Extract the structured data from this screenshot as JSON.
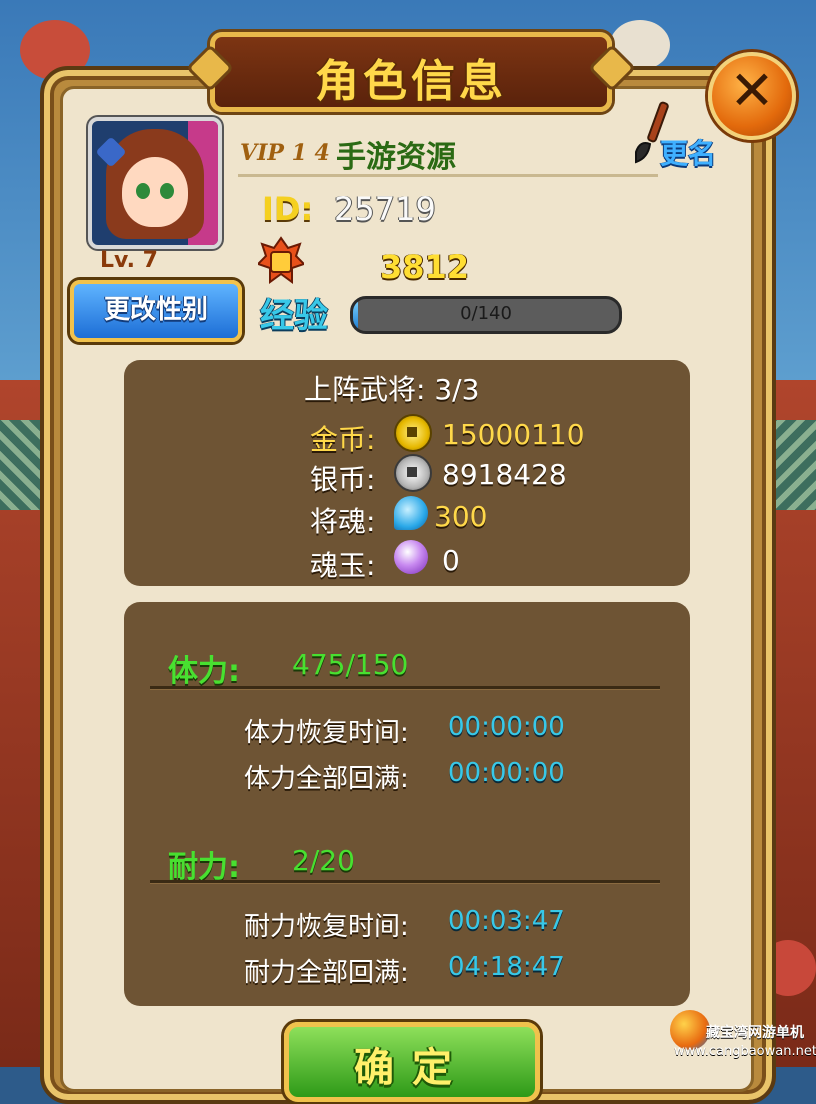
{
  "dialog": {
    "title": "角色信息",
    "close_symbol": "✕",
    "confirm_label": "确定"
  },
  "player": {
    "vip": "VIP 1 4",
    "name": "手游资源",
    "rename_label": "更名",
    "id_label": "ID:",
    "id_value": "25719",
    "level": "Lv. 7",
    "change_gender_label": "更改性别",
    "battle_power": "3812",
    "exp_label": "经验",
    "exp_text": "0/140",
    "exp_fraction": 0.02
  },
  "resources": {
    "generals": "上阵武将: 3/3",
    "gold_label": "金币:",
    "gold_value": "15000110",
    "silver_label": "银币:",
    "silver_value": "8918428",
    "soul_label": "将魂:",
    "soul_value": "300",
    "jade_label": "魂玉:",
    "jade_value": "0"
  },
  "stamina": {
    "label": "体力:",
    "value": "475/150",
    "recover_label": "体力恢复时间:",
    "recover_value": "00:00:00",
    "full_label": "体力全部回满:",
    "full_value": "00:00:00"
  },
  "endurance": {
    "label": "耐力:",
    "value": "2/20",
    "recover_label": "耐力恢复时间:",
    "recover_value": "00:03:47",
    "full_label": "耐力全部回满:",
    "full_value": "04:18:47"
  },
  "watermark": {
    "site_name": "藏宝湾网游单机",
    "site_url": "www.cangbaowan.net"
  },
  "icons": {
    "gold": "gold-coin-icon",
    "silver": "silver-coin-icon",
    "soul": "soul-icon",
    "jade": "jade-icon",
    "battle": "battle-icon",
    "rename": "brush-icon"
  },
  "colors": {
    "green_text": "#48e030",
    "cyan_text": "#38c8e8",
    "gold_text": "#ffde33",
    "panel_brown": "#6e5434"
  }
}
